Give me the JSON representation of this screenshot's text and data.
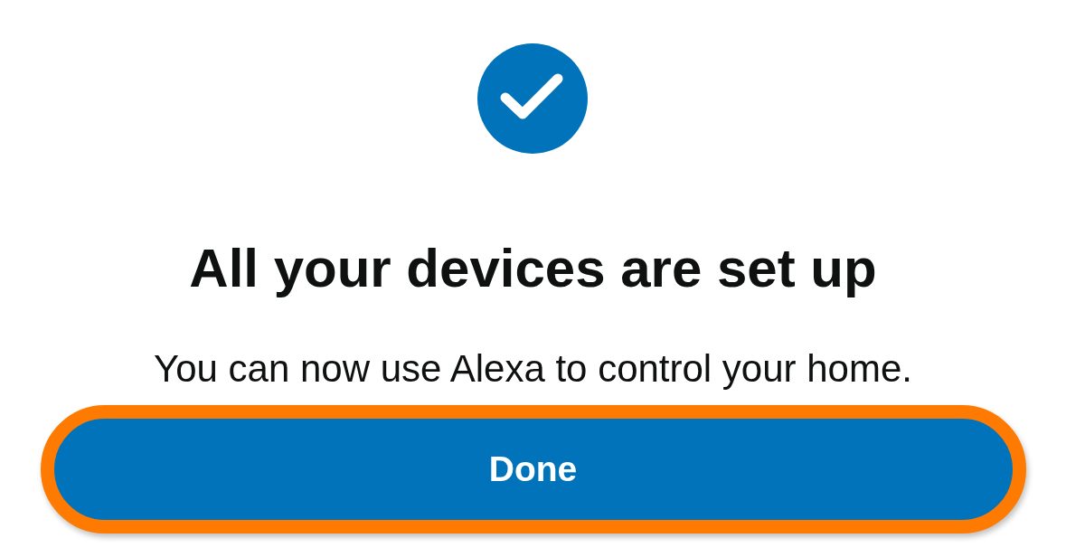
{
  "status": {
    "kind": "success"
  },
  "title": "All your devices are set up",
  "message": "You can now use Alexa to control your home.",
  "button": {
    "label": "Done",
    "highlighted": true
  }
}
